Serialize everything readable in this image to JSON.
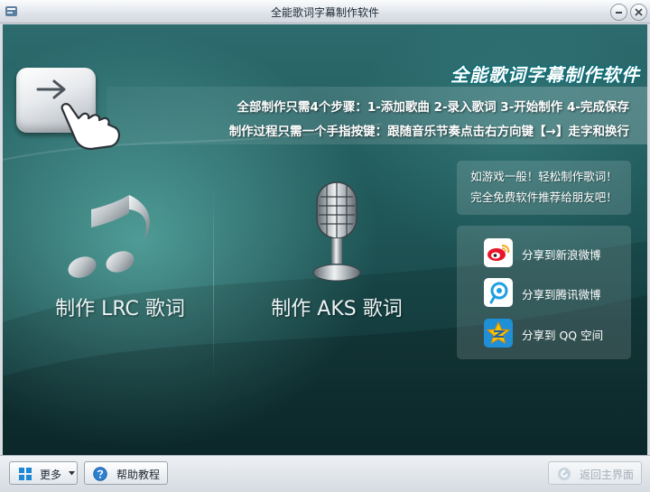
{
  "window": {
    "title": "全能歌词字幕制作软件"
  },
  "banner": {
    "app_title": "全能歌词字幕制作软件",
    "steps_line": "全部制作只需4个步骤：1-添加歌曲  2-录入歌词  3-开始制作  4-完成保存",
    "tip_line": "制作过程只需一个手指按键：跟随音乐节奏点击右方向键【→】走字和换行"
  },
  "actions": {
    "make_lrc": "制作 LRC 歌词",
    "make_aks": "制作 AKS 歌词"
  },
  "promo": {
    "line1": "如游戏一般！轻松制作歌词！",
    "line2": "完全免费软件推荐给朋友吧！"
  },
  "share": {
    "items": [
      {
        "label": "分享到新浪微博",
        "icon": "sina-weibo-icon",
        "color": "#e6162d"
      },
      {
        "label": "分享到腾讯微博",
        "icon": "tencent-weibo-icon",
        "color": "#1f9fe3"
      },
      {
        "label": "分享到 QQ 空间",
        "icon": "qzone-icon",
        "color": "#f5b400"
      }
    ]
  },
  "statusbar": {
    "more": "更多",
    "help": "帮助教程",
    "back": "返回主界面"
  },
  "colors": {
    "background_top": "#2c6b6e",
    "background_bottom": "#113538",
    "title_outline": "#0c6d77"
  }
}
